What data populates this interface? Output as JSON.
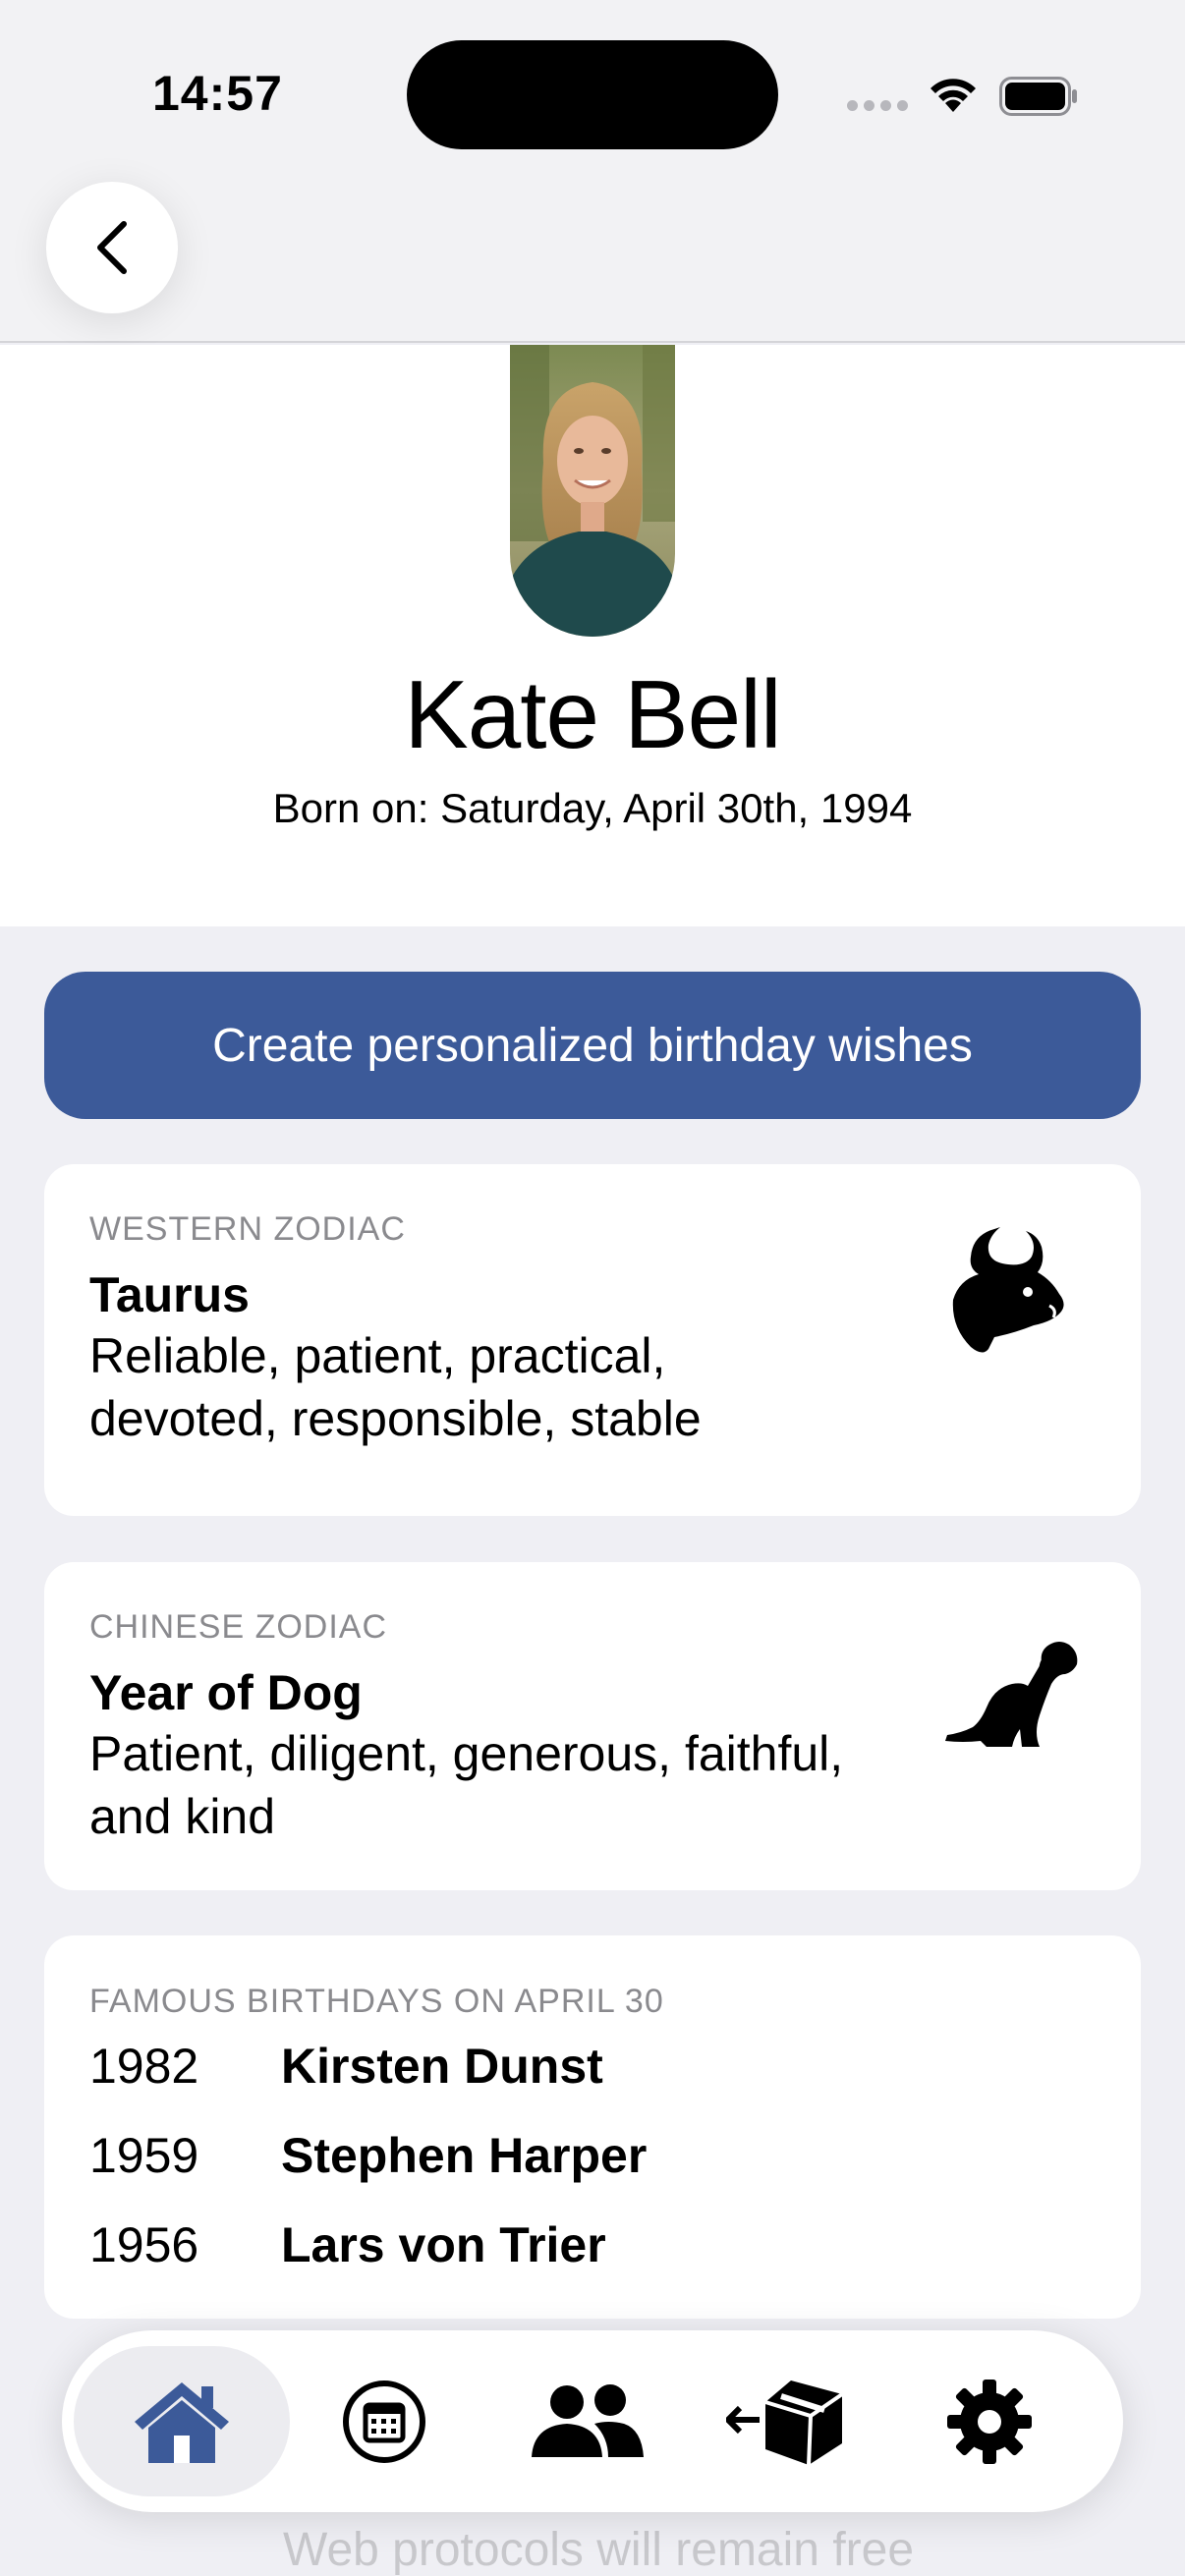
{
  "status_bar": {
    "time": "14:57"
  },
  "profile": {
    "name": "Kate Bell",
    "born": "Born on: Saturday, April 30th, 1994"
  },
  "wish_button": {
    "label": "Create personalized birthday wishes"
  },
  "western_zodiac": {
    "label": "WESTERN ZODIAC",
    "sign": "Taurus",
    "line1": "Reliable, patient, practical,",
    "line2": "devoted, responsible, stable",
    "icon": "bull-icon"
  },
  "chinese_zodiac": {
    "label": "CHINESE ZODIAC",
    "sign": "Year of Dog",
    "line1": "Patient, diligent, generous, faithful,",
    "line2": "and kind",
    "icon": "dog-icon"
  },
  "famous": {
    "label": "FAMOUS BIRTHDAYS ON APRIL 30",
    "rows": [
      {
        "year": "1982",
        "name": "Kirsten Dunst"
      },
      {
        "year": "1959",
        "name": "Stephen Harper"
      },
      {
        "year": "1956",
        "name": "Lars von Trier"
      }
    ]
  },
  "faded_text": "Web protocols will remain free",
  "tabbar": {
    "tabs": [
      "home",
      "calendar",
      "contacts",
      "export",
      "settings"
    ],
    "active": "home"
  },
  "colors": {
    "accent": "#3c5a99",
    "active_tab_icon": "#3c5a99",
    "background": "#efeff4"
  }
}
